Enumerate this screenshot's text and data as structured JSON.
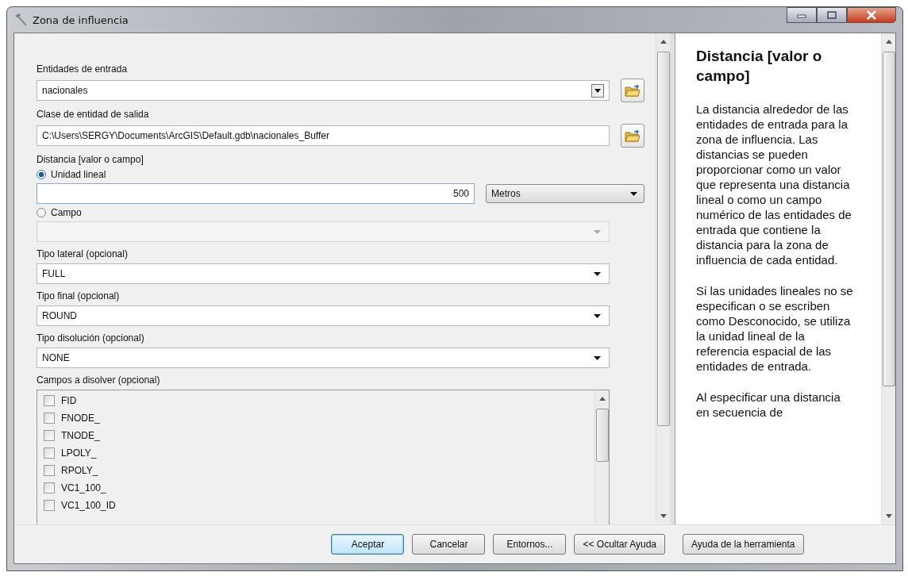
{
  "window": {
    "title": "Zona de influencia"
  },
  "parameters": [
    {
      "kind": "label",
      "text": "Entidades de entrada"
    },
    {
      "kind": "combo",
      "value": "nacionales",
      "browse": true
    },
    {
      "kind": "label",
      "text": "Clase de entidad de salida"
    },
    {
      "kind": "text",
      "value": "C:\\Users\\SERGY\\Documents\\ArcGIS\\Default.gdb\\nacionales_Buffer",
      "browse": true
    },
    {
      "kind": "label",
      "text": "Distancia [valor o campo]"
    },
    {
      "kind": "radio",
      "text": "Unidad lineal",
      "selected": true
    },
    {
      "kind": "linear",
      "value": "500",
      "unit": "Metros"
    },
    {
      "kind": "radio",
      "text": "Campo",
      "selected": false
    },
    {
      "kind": "dropdown",
      "disabled": true
    },
    {
      "kind": "label",
      "text": "Tipo lateral (opcional)"
    },
    {
      "kind": "dropdown",
      "value": "FULL",
      "disabled": false
    },
    {
      "kind": "label",
      "text": "Tipo final (opcional)"
    },
    {
      "kind": "dropdown",
      "value": "ROUND",
      "disabled": false
    },
    {
      "kind": "label",
      "text": "Tipo disolución (opcional)"
    },
    {
      "kind": "dropdown",
      "value": "NONE",
      "disabled": false
    },
    {
      "kind": "label",
      "text": "Campos a disolver (opcional)"
    },
    {
      "kind": "checklist",
      "items": [
        {
          "text": "FID",
          "checked": false
        },
        {
          "text": "FNODE_",
          "checked": false
        },
        {
          "text": "TNODE_",
          "checked": false
        },
        {
          "text": "LPOLY_",
          "checked": false
        },
        {
          "text": "RPOLY_",
          "checked": false
        },
        {
          "text": "VC1_100_",
          "checked": false
        },
        {
          "text": "VC1_100_ID",
          "checked": false
        }
      ]
    }
  ],
  "help": {
    "title": "Distancia [valor o campo]",
    "paragraphs": [
      "La distancia alrededor de las entidades de entrada para la zona de influencia. Las distancias se pueden proporcionar como un valor que representa una distancia lineal o como un campo numérico de las entidades de entrada que contiene la distancia para la zona de influencia de cada entidad.",
      "Si las unidades lineales no se especifican o se escriben como Desconocido, se utiliza la unidad lineal de la referencia espacial de las entidades de entrada.",
      "Al especificar una distancia en secuencia de"
    ]
  },
  "buttons": [
    {
      "label": "Aceptar",
      "default": true
    },
    {
      "label": "Cancelar",
      "default": false
    },
    {
      "label": "Entornos...",
      "default": false
    },
    {
      "label": "<< Ocultar Ayuda",
      "default": false
    }
  ],
  "help_button": "Ayuda de la herramienta"
}
